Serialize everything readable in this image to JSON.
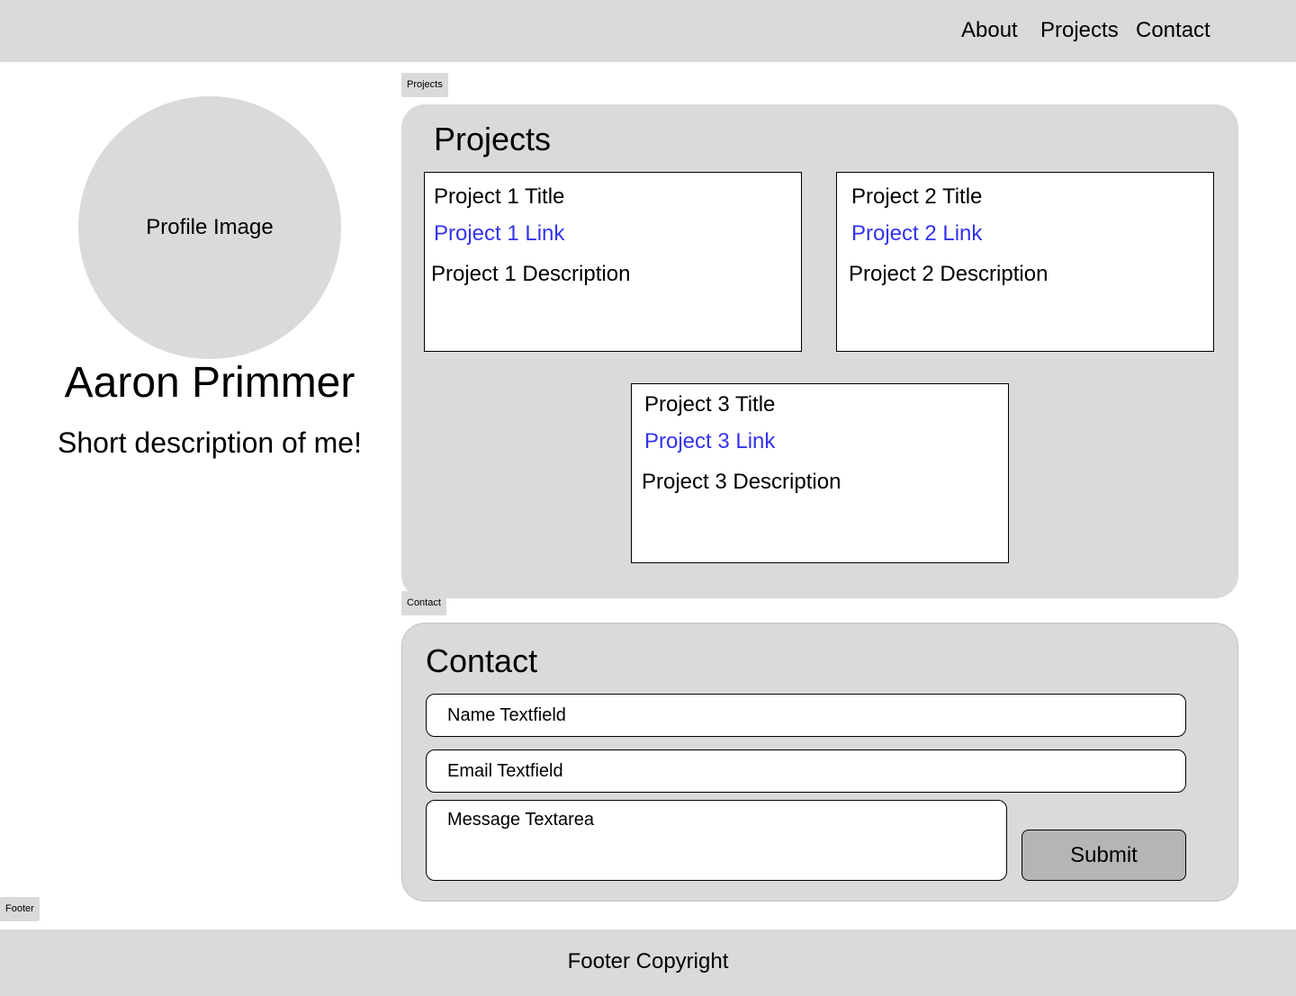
{
  "nav": {
    "about": "About",
    "projects": "Projects",
    "contact": "Contact"
  },
  "profile": {
    "image_label": "Profile Image",
    "name": "Aaron Primmer",
    "description": "Short description of me!"
  },
  "projects": {
    "frame_tag": "Projects",
    "heading": "Projects",
    "cards": [
      {
        "title": "Project 1 Title",
        "link": "Project 1 Link",
        "description": "Project 1 Description"
      },
      {
        "title": "Project 2 Title",
        "link": "Project 2 Link",
        "description": "Project 2 Description"
      },
      {
        "title": "Project 3 Title",
        "link": "Project 3 Link",
        "description": "Project 3 Description"
      }
    ]
  },
  "contact": {
    "frame_tag": "Contact",
    "heading": "Contact",
    "name_placeholder": "Name Textfield",
    "email_placeholder": "Email Textfield",
    "message_placeholder": "Message Textarea",
    "submit_label": "Submit"
  },
  "footer": {
    "frame_tag": "Footer",
    "copyright": "Footer Copyright"
  },
  "colors": {
    "panel_gray": "#dbd9da",
    "link_blue": "#3333ee",
    "button_gray": "#b5b5b5"
  }
}
